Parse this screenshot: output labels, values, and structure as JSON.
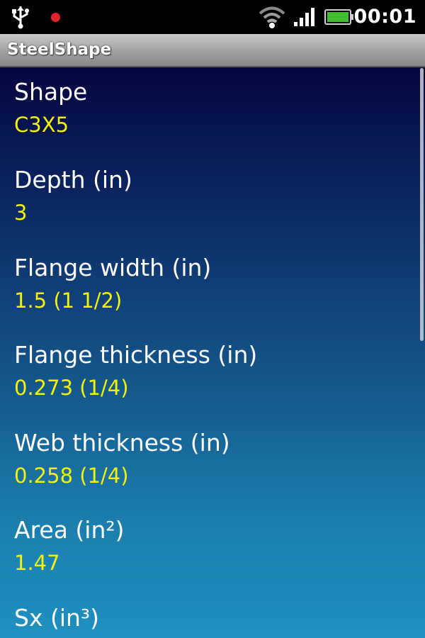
{
  "status_bar": {
    "time": "00:01",
    "icons": [
      "usb-icon",
      "notification-dot-icon",
      "wifi-icon",
      "signal-icon",
      "battery-icon"
    ],
    "notification_color": "#e0242b",
    "battery_color": "#3fbf2f"
  },
  "app": {
    "title": "SteelShape"
  },
  "properties": [
    {
      "label": "Shape",
      "value": "C3X5"
    },
    {
      "label": "Depth (in)",
      "value": "3"
    },
    {
      "label": "Flange width (in)",
      "value": "1.5  (1 1/2)"
    },
    {
      "label": "Flange thickness (in)",
      "value": "0.273  (1/4)"
    },
    {
      "label": "Web thickness (in)",
      "value": "0.258  (1/4)"
    },
    {
      "label": "Area (in²)",
      "value": "1.47"
    },
    {
      "label": "Sx (in³)",
      "value": ""
    }
  ],
  "colors": {
    "label": "#ffffff",
    "value": "#f2f20a",
    "background_top": "#05063f",
    "background_bottom": "#1f90c0"
  }
}
